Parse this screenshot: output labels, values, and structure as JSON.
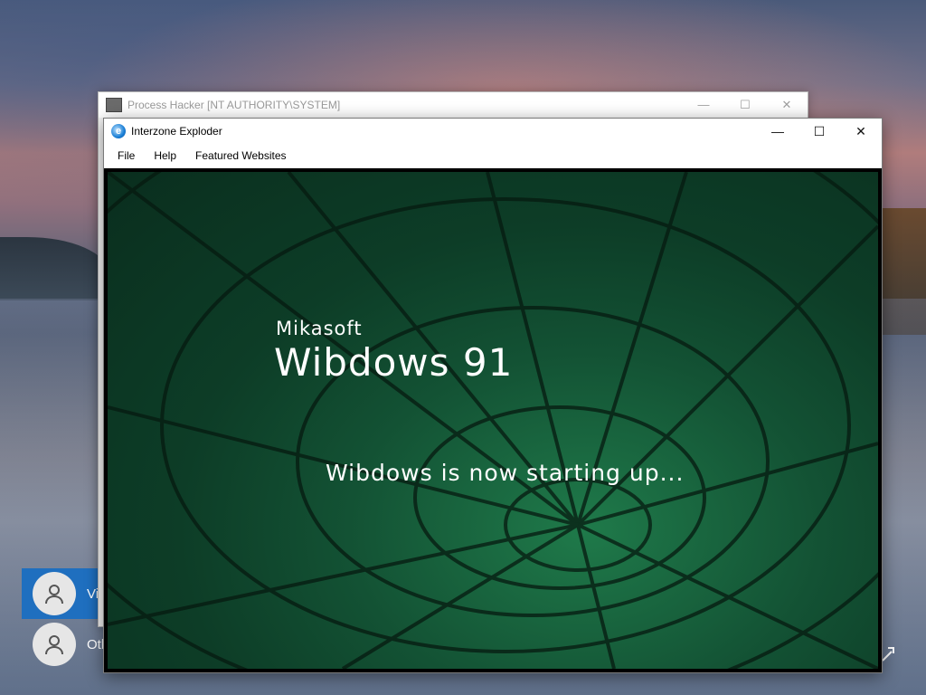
{
  "desktop": {
    "users": [
      {
        "label": "Vi"
      },
      {
        "label": "Oth"
      }
    ]
  },
  "process_hacker": {
    "title": "Process Hacker [NT AUTHORITY\\SYSTEM]",
    "controls": {
      "minimize": "—",
      "maximize": "☐",
      "close": "✕"
    }
  },
  "browser": {
    "title": "Interzone Exploder",
    "icon_letter": "e",
    "controls": {
      "minimize": "—",
      "maximize": "☐",
      "close": "✕"
    },
    "menu": [
      "File",
      "Help",
      "Featured Websites"
    ]
  },
  "boot_screen": {
    "vendor": "Mikasoft",
    "product": "Wibdows 91",
    "status": "Wibdows is now starting up..."
  },
  "colors": {
    "selected_user_bg": "#1f6fbf",
    "tunnel_green": "#135234"
  }
}
